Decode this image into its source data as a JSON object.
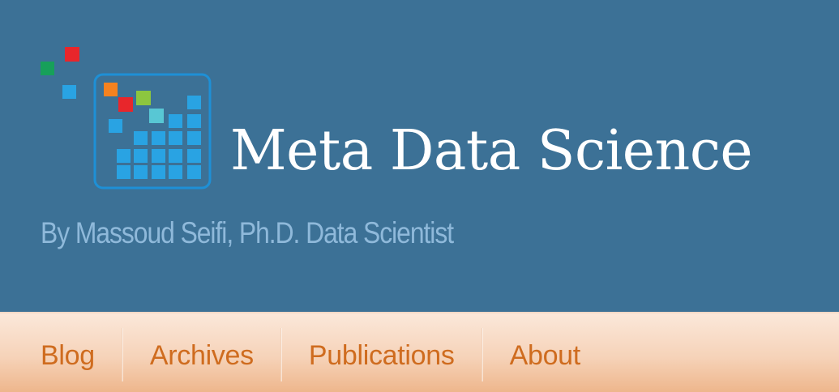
{
  "site": {
    "title": "Meta Data Science",
    "byline": "By Massoud Seifi, Ph.D. Data Scientist"
  },
  "logo": {
    "icon": "data-grid-logo-icon",
    "colors": {
      "accent_blue": "#29a3e3",
      "frame_blue": "#1e90d6",
      "red": "#e8262b",
      "green": "#17a05a",
      "orange": "#f5821f",
      "lime": "#8cc63f",
      "teal": "#58c7d4"
    }
  },
  "nav": {
    "items": [
      {
        "label": "Blog"
      },
      {
        "label": "Archives"
      },
      {
        "label": "Publications"
      },
      {
        "label": "About"
      }
    ]
  },
  "colors": {
    "header_bg": "#3c7196",
    "title": "#ffffff",
    "byline": "#8fb9da",
    "nav_text": "#cf6c1f",
    "nav_bg_top": "#fbe8da",
    "nav_bg_bottom": "#eeb68c"
  }
}
